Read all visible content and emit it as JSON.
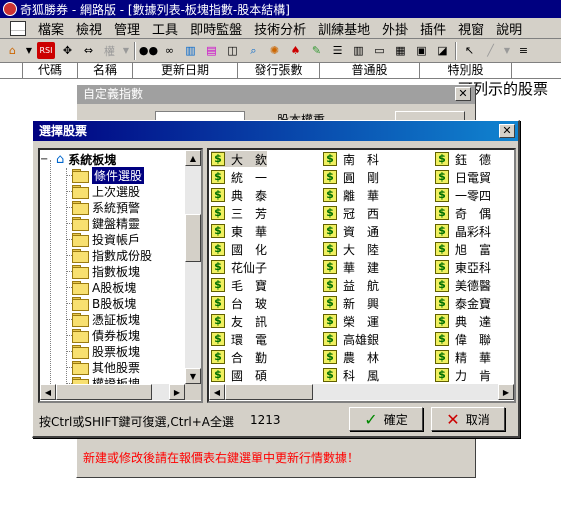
{
  "window": {
    "title": "奇狐勝券 - 網路版 - [數據列表-板塊指數-股本結構]"
  },
  "menu": [
    "檔案",
    "檢視",
    "管理",
    "工具",
    "即時監盤",
    "技術分析",
    "訓練基地",
    "外掛",
    "插件",
    "視窗",
    "說明"
  ],
  "columns": [
    "代碼",
    "名稱",
    "更新日期",
    "發行張數",
    "普通股",
    "特別股"
  ],
  "bg_dialog": {
    "title": "自定義指數",
    "group_label": "股本權重",
    "note": "新建或修改後請在報價表右鍵選單中更新行情數據！"
  },
  "hint_behind": "可列示的股票",
  "dialog": {
    "title": "選擇股票",
    "hint": "按Ctrl或SHIFT鍵可復選,Ctrl+A全選",
    "count": "1213",
    "ok_label": "確定",
    "cancel_label": "取消"
  },
  "tree": {
    "root": "系統板塊",
    "items": [
      "條件選股",
      "上次選股",
      "系統預警",
      "鍵盤精靈",
      "投資帳戶",
      "指數成份股",
      "指數板塊",
      "A股板塊",
      "B股板塊",
      "憑証板塊",
      "債券板塊",
      "股票板塊",
      "其他股票",
      "權證板塊"
    ]
  },
  "stocks": {
    "col1": [
      "大　欽",
      "統　一",
      "典　泰",
      "三　芳",
      "東　華",
      "國　化",
      "花仙子",
      "毛　寶",
      "台　玻",
      "友　訊",
      "環　電",
      "合　勤",
      "國　碩"
    ],
    "col2": [
      "南　科",
      "圓　剛",
      "離　華",
      "冠　西",
      "資　通",
      "大　陸",
      "華　建",
      "益　航",
      "新　興",
      "榮　運",
      "高雄銀",
      "農　林",
      "科　風"
    ],
    "col3": [
      "鈺　德",
      "日電貿",
      "一零四",
      "奇　偶",
      "晶彩科",
      "旭　富",
      "東亞科",
      "美德醫",
      "泰金寶",
      "典　達",
      "偉　聯",
      "精　華",
      "力　肯"
    ]
  },
  "colors": {
    "title_active": "#000080",
    "note_red": "#ff0000",
    "panel": "#d4d0c8"
  }
}
